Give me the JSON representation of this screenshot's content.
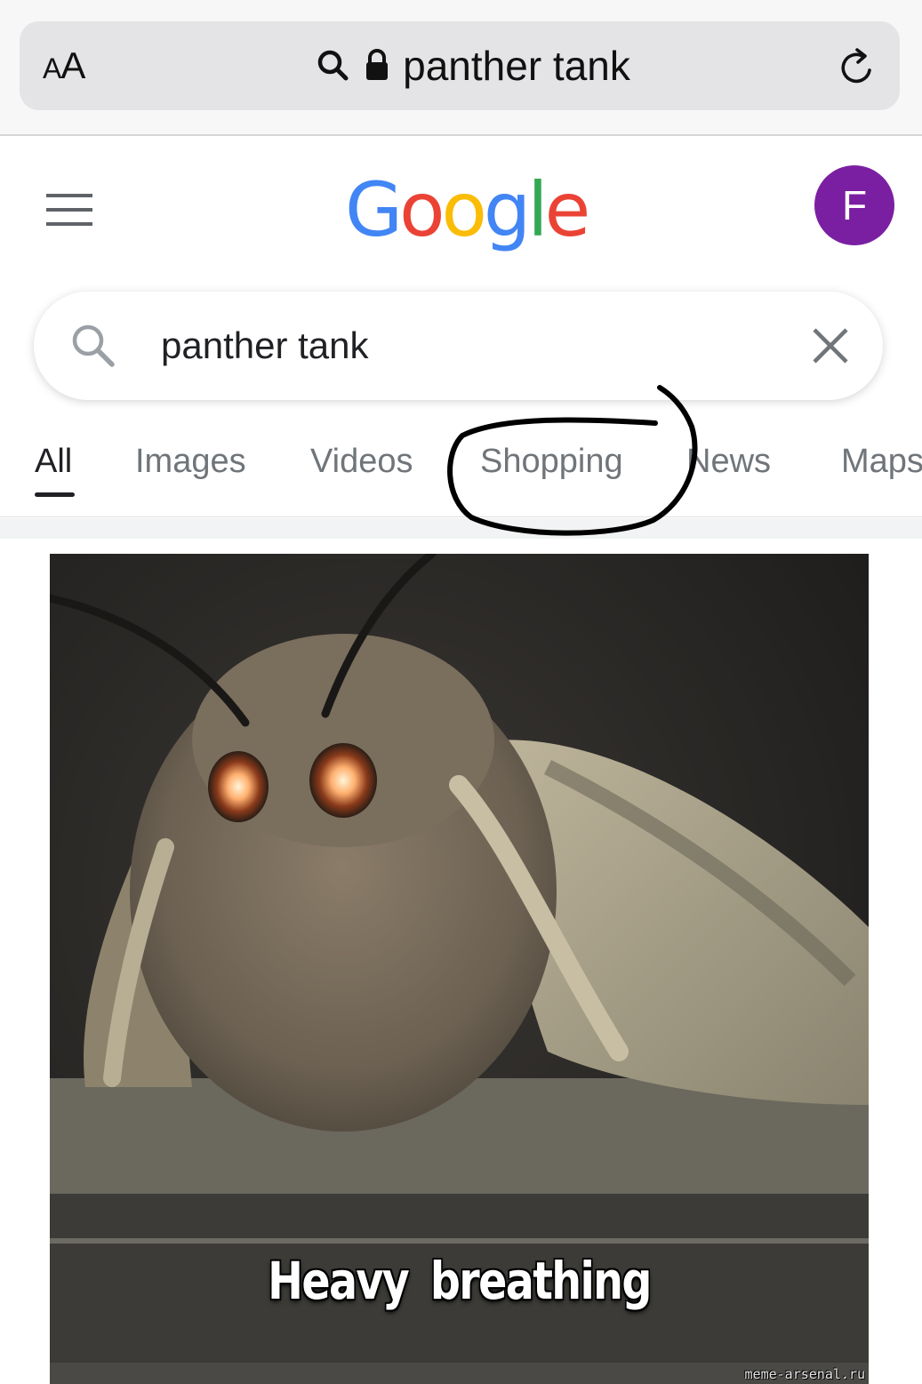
{
  "browser": {
    "text_size_button": "AA",
    "url_text": "panther tank"
  },
  "google": {
    "logo_letters": [
      "G",
      "o",
      "o",
      "g",
      "l",
      "e"
    ],
    "avatar_initial": "F"
  },
  "search": {
    "query": "panther tank"
  },
  "tabs": [
    {
      "label": "All",
      "active": true
    },
    {
      "label": "Images",
      "active": false
    },
    {
      "label": "Videos",
      "active": false
    },
    {
      "label": "Shopping",
      "active": false
    },
    {
      "label": "News",
      "active": false
    },
    {
      "label": "Maps",
      "active": false
    }
  ],
  "result_image": {
    "caption": "Heavy  breathing",
    "watermark": "meme-arsenal.ru"
  },
  "icons": {
    "search": "search-icon",
    "lock": "lock-icon",
    "reload": "reload-icon",
    "menu": "hamburger-menu-icon",
    "clear": "close-icon"
  },
  "colors": {
    "avatar": "#7b1fa2",
    "google_blue": "#4285F4",
    "google_red": "#EA4335",
    "google_yellow": "#FBBC05",
    "google_green": "#34A853",
    "scribble": "#000000"
  }
}
